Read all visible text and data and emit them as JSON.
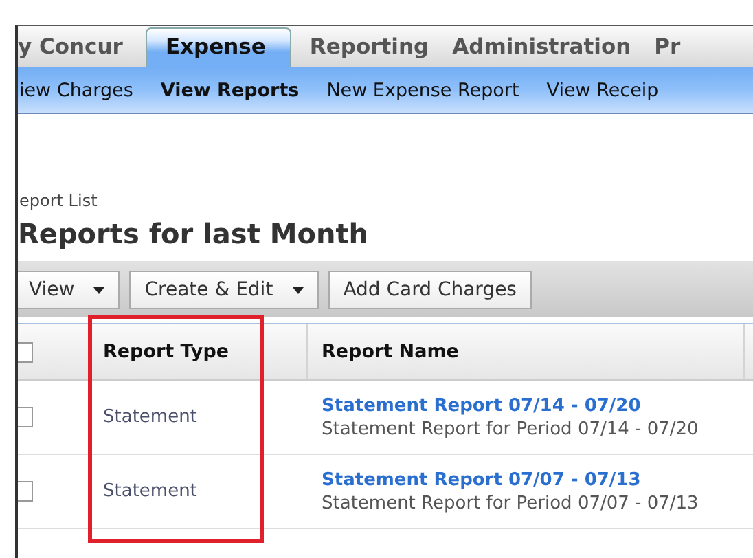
{
  "tabs": [
    {
      "label": "y Concur",
      "selected": false
    },
    {
      "label": "Expense",
      "selected": true
    },
    {
      "label": "Reporting",
      "selected": false
    },
    {
      "label": "Administration",
      "selected": false
    },
    {
      "label": "Pr",
      "selected": false
    }
  ],
  "subnav": [
    {
      "label": "iew Charges",
      "selected": false
    },
    {
      "label": "View Reports",
      "selected": true
    },
    {
      "label": "New Expense Report",
      "selected": false
    },
    {
      "label": "View Receip",
      "selected": false
    }
  ],
  "breadcrumb": "eport List",
  "title": "Reports for last Month",
  "toolbar": [
    {
      "label": "View",
      "kind": "dropdown"
    },
    {
      "label": "Create & Edit",
      "kind": "dropdown"
    },
    {
      "label": "Add Card Charges",
      "kind": "button"
    }
  ],
  "table": {
    "header_checked": false,
    "columns": [
      {
        "label": "Report Type",
        "highlighted": true
      },
      {
        "label": "Report Name",
        "highlighted": false
      }
    ],
    "rows": [
      {
        "checked": false,
        "report_type": "Statement",
        "report_name": "Statement Report 07/14 - 07/20",
        "description": "Statement Report for Period 07/14 - 07/20"
      },
      {
        "checked": false,
        "report_type": "Statement",
        "report_name": "Statement Report 07/07 - 07/13",
        "description": "Statement Report for Period 07/07 - 07/13"
      }
    ]
  }
}
